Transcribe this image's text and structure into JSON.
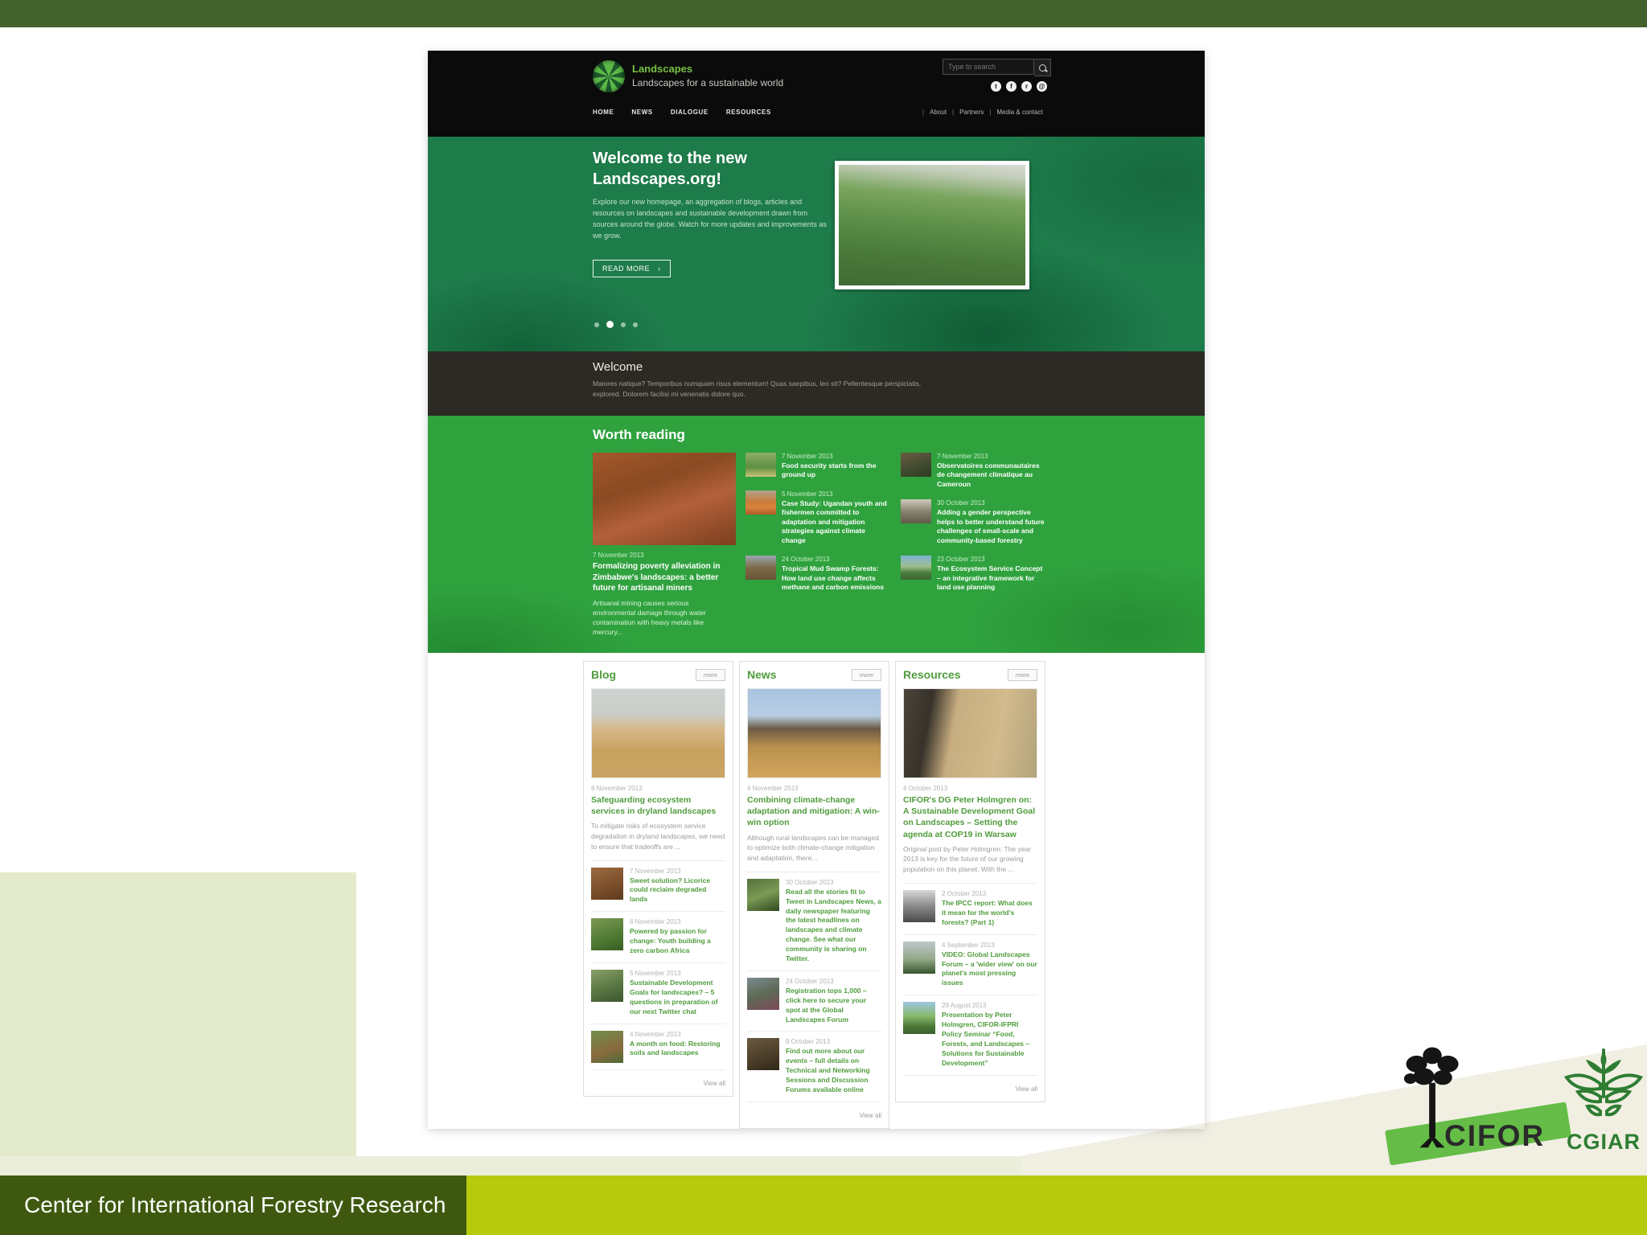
{
  "slide": {
    "footer_text": "Center for International Forestry Research",
    "colors": {
      "topbar_green": "#44622d",
      "footer_dark_green": "#3e590f",
      "footer_lime": "#b5cb0b",
      "sage_block": "#e4ebcd",
      "cream_strip": "#ebeeda",
      "beige_diag": "#f1efe2",
      "hero_green": "#1e7b4a",
      "worth_green": "#2fa23e",
      "link_green": "#4f9c3c"
    },
    "logos": {
      "cifor": "CIFOR",
      "cgiar": "CGIAR"
    }
  },
  "site": {
    "brand": {
      "name": "Landscapes",
      "tagline": "Landscapes for a sustainable world"
    },
    "search": {
      "placeholder": "Type to search"
    },
    "social": [
      {
        "name": "twitter",
        "glyph": "t"
      },
      {
        "name": "facebook",
        "glyph": "f"
      },
      {
        "name": "rss",
        "glyph": "r"
      },
      {
        "name": "email",
        "glyph": "@"
      }
    ],
    "nav": [
      {
        "label": "HOME"
      },
      {
        "label": "NEWS"
      },
      {
        "label": "DIALOGUE"
      },
      {
        "label": "RESOURCES"
      }
    ],
    "subnav": [
      {
        "label": "About"
      },
      {
        "label": "Partners"
      },
      {
        "label": "Media & contact"
      }
    ],
    "hero": {
      "title_line1": "Welcome to the new",
      "title_line2": "Landscapes.org!",
      "body": "Explore our new homepage, an aggregation of blogs, articles and resources on landscapes and sustainable development drawn from sources around the globe. Watch for more updates and improvements as we grow.",
      "button": "READ MORE",
      "button_arrow": "›",
      "image_bg": "linear-gradient(185deg,#d8dcd4 0%,#c2cdb8 10%,#7aa55f 28%,#5c8f48 50%,#49793a 75%,#3f6c33 100%)",
      "dots": {
        "count": 4,
        "active": 1
      }
    },
    "welcome": {
      "title": "Welcome",
      "body": "Maiores natique? Temporibus numquam risus elementum! Quas saepibus, leo sit? Pellentesque perspiciatis, explored. Dolorem facilisi mi venenatis dolore quo."
    },
    "worth_reading": {
      "title": "Worth reading",
      "featured": {
        "date": "7 November 2013",
        "title": "Formalizing poverty alleviation in Zimbabwe's landscapes: a better future for artisanal miners",
        "teaser": "Artisanal mining causes serious environmental damage through water contamination with heavy metals like mercury...",
        "bg": "linear-gradient(160deg,#a4572b 0%,#8a4a22 35%,#b3603a 60%,#7c3f1e 100%)"
      },
      "items_col2": [
        {
          "date": "7 November 2013",
          "title": "Food security starts from the ground up",
          "bg": "linear-gradient(180deg,#8fae6a 0%,#5d8f3f 60%,#c9c27a 100%)"
        },
        {
          "date": "5 November 2013",
          "title": "Case Study: Ugandan youth and fishermen committed to adaptation and mitigation strategies against climate change",
          "bg": "linear-gradient(180deg,#b0a58e 0%,#c97b3a 45%,#d9833b 70%,#b05b2a 100%)"
        },
        {
          "date": "24 October 2013",
          "title": "Tropical Mud Swamp Forests: How land use change affects methane and carbon emissions",
          "bg": "linear-gradient(180deg,#9aa7b0 0%,#7d6a4a 50%,#6b5436 100%)"
        }
      ],
      "items_col3": [
        {
          "date": "7 November 2013",
          "title": "Observatoires communautaires de changement climatique au Cameroun",
          "bg": "linear-gradient(160deg,#6a5b43 0%,#3f4a2e 60%,#2e3b22 100%)"
        },
        {
          "date": "30 October 2013",
          "title": "Adding a gender perspective helps to better understand future challenges of small-scale and community-based forestry",
          "bg": "linear-gradient(180deg,#cfc9bd 0%,#8a8270 50%,#5f5948 100%)"
        },
        {
          "date": "23 October 2013",
          "title": "The Ecosystem Service Concept – an integrative framework for land use planning",
          "bg": "linear-gradient(180deg,#7fb3d6 0%,#9fbf8e 45%,#4c7d3e 70%,#3b6631 100%)"
        }
      ]
    },
    "columns": [
      {
        "title": "Blog",
        "more_label": "more",
        "view_all": "View all",
        "featured": {
          "date": "8 November 2013",
          "title": "Safeguarding ecosystem services in dryland landscapes",
          "teaser": "To mitigate risks of ecosystem service degradation in dryland landscapes, we need to ensure that tradeoffs are ...",
          "bg": "linear-gradient(180deg,#cdd3d2 0%,#c9cdc6 28%,#d6b98a 45%,#c8a15e 70%,#caa565 100%)"
        },
        "items": [
          {
            "date": "7 November 2013",
            "title": "Sweet solution? Licorice could reclaim degraded lands",
            "bg": "linear-gradient(160deg,#9b6b42 0%,#7a4e2a 60%,#5e3a1e 100%)"
          },
          {
            "date": "6 November 2013",
            "title": "Powered by passion for change: Youth building a zero carbon Africa",
            "bg": "linear-gradient(160deg,#7e9a55 0%,#4e7a33 60%,#365d24 100%)"
          },
          {
            "date": "5 November 2013",
            "title": "Sustainable Development Goals for landscapes? – 5 questions in preparation of our next Twitter chat",
            "bg": "linear-gradient(160deg,#8aa06a 0%,#5c7a44 50%,#3c5530 100%)"
          },
          {
            "date": "4 November 2013",
            "title": "A month on food: Restoring soils and landscapes",
            "bg": "linear-gradient(160deg,#6f8f4e 0%,#8a6a3e 60%,#4e6a35 100%)"
          }
        ]
      },
      {
        "title": "News",
        "more_label": "more",
        "view_all": "View all",
        "featured": {
          "date": "4 November 2013",
          "title": "Combining climate-change adaptation and mitigation: A win-win option",
          "teaser": "Although rural landscapes can be managed to optimize both climate-change mitigation and adaptation, there...",
          "bg": "linear-gradient(180deg,#a9c4e0 0%,#b7cde4 30%,#6b5a44 45%,#b98f4e 65%,#d1a75c 100%)"
        },
        "items": [
          {
            "date": "30 October 2013",
            "title": "Read all the stories fit to Tweet in Landscapes News, a daily newspaper featuring the latest headlines on landscapes and climate change. See what our community is sharing on Twitter.",
            "bg": "linear-gradient(160deg,#55703c 0%,#7a9a55 50%,#32491f 100%)"
          },
          {
            "date": "24 October 2013",
            "title": "Registration tops 1,000 – click here to secure your spot at the Global Landscapes Forum",
            "bg": "linear-gradient(160deg,#7b8a8f 0%,#5d6a55 50%,#7e4a5a 100%)"
          },
          {
            "date": "9 October 2013",
            "title": "Find out more about our events – full details on Technical and Networking Sessions and Discussion Forums available online",
            "bg": "linear-gradient(160deg,#6a5a40 0%,#4a3c28 60%,#2f2718 100%)"
          }
        ]
      },
      {
        "title": "Resources",
        "more_label": "more",
        "view_all": "View all",
        "featured": {
          "date": "4 October 2013",
          "title": "CIFOR's DG Peter Holmgren on: A Sustainable Development Goal on Landscapes – Setting the agenda at COP19 in Warsaw",
          "teaser": "Original post by Peter Holmgren: The year 2013 is key for the future of our growing population on this planet. With the ...",
          "bg": "linear-gradient(100deg,#4a443a 0%,#37322a 20%,#c7ad80 38%,#d2ba8c 70%,#b3a37c 100%)"
        },
        "items": [
          {
            "date": "2 October 2013",
            "title": "The IPCC report: What does it mean for the world's forests? (Part 1)",
            "bg": "linear-gradient(180deg,#d8d8d8 0%,#8a8a8a 50%,#4a4a4a 100%)"
          },
          {
            "date": "4 September 2013",
            "title": "VIDEO: Global Landscapes Forum – a 'wider view' on our planet's most pressing issues",
            "bg": "linear-gradient(180deg,#bcc8cc 0%,#93a887 55%,#37552c 100%)"
          },
          {
            "date": "29 August 2013",
            "title": "Presentation by Peter Holmgren, CIFOR-IFPRI Policy Seminar “Food, Forests, and Landscapes – Solutions for Sustainable Development”",
            "bg": "linear-gradient(180deg,#9ec7e2 0%,#88b86a 45%,#4e7a3a 75%,#3a6030 100%)"
          }
        ]
      }
    ]
  }
}
